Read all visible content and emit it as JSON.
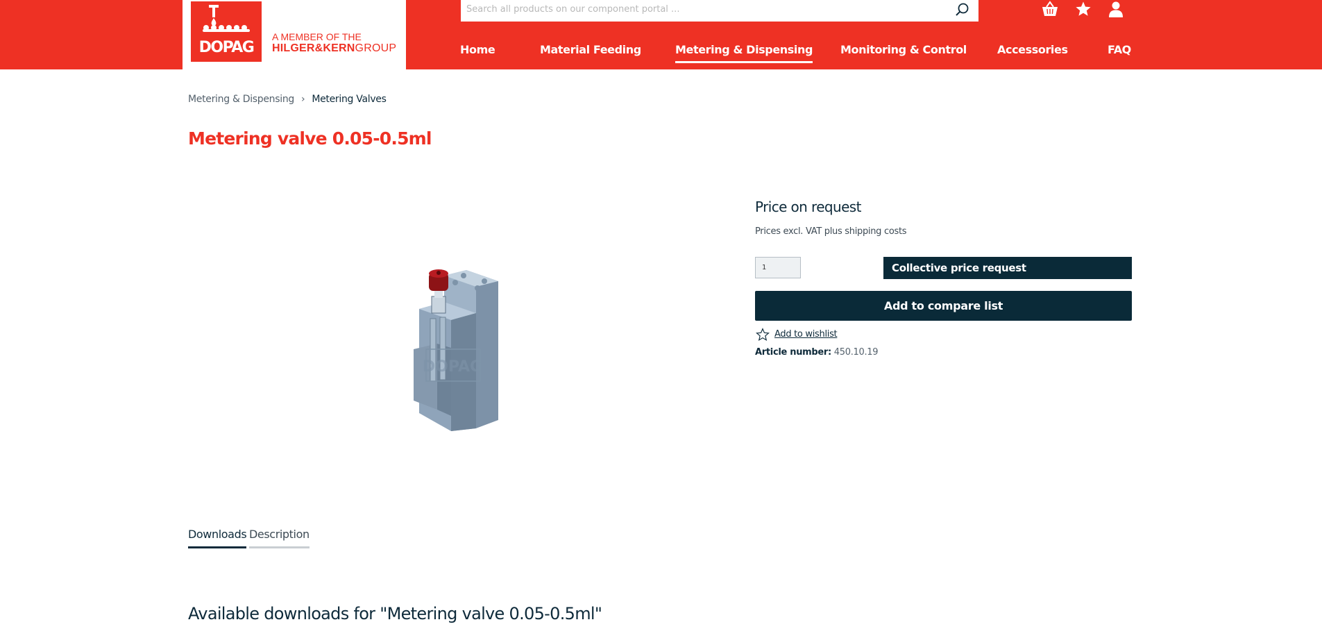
{
  "brand": {
    "logo_text": "DOPAG",
    "member_line1": "A MEMBER OF THE",
    "member_line2_bold": "HILGER&KERN",
    "member_line2_regular": "GROUP",
    "brand_red": "#ee3124",
    "dark_navy": "#0a2a38"
  },
  "search": {
    "placeholder": "Search all products on our component portal ..."
  },
  "header_icons": [
    "basket-icon",
    "star-icon",
    "user-icon"
  ],
  "nav": [
    {
      "label": "Home",
      "active": false
    },
    {
      "label": "Material Feeding",
      "active": false
    },
    {
      "label": "Metering & Dispensing",
      "active": true
    },
    {
      "label": "Monitoring & Control",
      "active": false
    },
    {
      "label": "Accessories",
      "active": false
    },
    {
      "label": "FAQ",
      "active": false
    }
  ],
  "breadcrumb": {
    "parent": "Metering & Dispensing",
    "current": "Metering Valves"
  },
  "product": {
    "title": "Metering valve 0.05-0.5ml",
    "price_label": "Price on request",
    "vat_note": "Prices excl. VAT plus shipping costs",
    "quantity": "1",
    "collective_btn": "Collective price request",
    "compare_btn": "Add to compare list",
    "wishlist_label": "Add to wishlist",
    "article_key": "Article number:",
    "article_value": "450.10.19",
    "image_watermark": "DOPAG"
  },
  "tabs": [
    {
      "label": "Downloads",
      "active": true
    },
    {
      "label": "Description",
      "active": false
    }
  ],
  "downloads": {
    "heading": "Available downloads for \"Metering valve 0.05-0.5ml\""
  }
}
